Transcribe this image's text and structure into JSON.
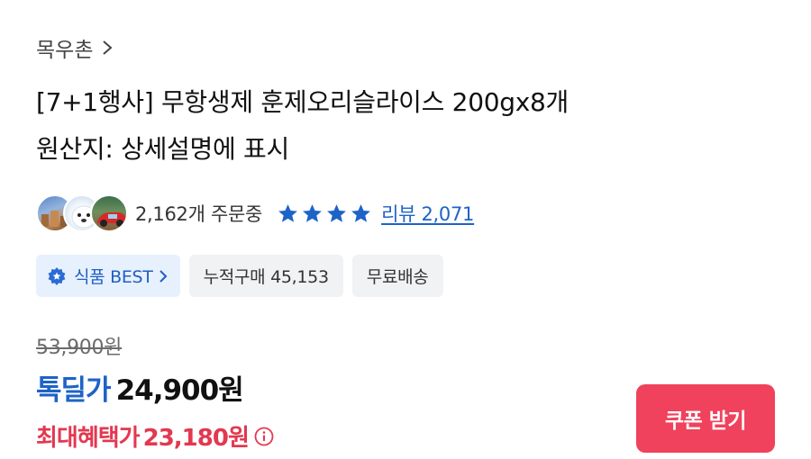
{
  "seller": {
    "name": "목우촌"
  },
  "product": {
    "title_line1": "[7+1행사] 무항생제 훈제오리슬라이스 200gx8개",
    "title_line2": "원산지: 상세설명에 표시"
  },
  "stats": {
    "orders_text": "2,162개 주문중",
    "rating_stars": 4,
    "review_link": "리뷰 2,071"
  },
  "badges": {
    "best_label": "식품 BEST",
    "cumulative_label": "누적구매 45,153",
    "shipping_label": "무료배송"
  },
  "pricing": {
    "original_price": "53,900원",
    "deal_label": "톡딜가",
    "deal_price": "24,900원",
    "max_benefit_label": "최대혜택가",
    "max_benefit_price": "23,180원"
  },
  "actions": {
    "coupon_button": "쿠폰 받기"
  },
  "icons": {
    "seller_chevron": "chevron-right-icon",
    "star": "star-icon",
    "medal": "medal-icon",
    "info": "info-icon"
  },
  "colors": {
    "accent_blue": "#1e63c7",
    "accent_red": "#e33850",
    "coupon_bg": "#f0425c",
    "best_badge_bg": "#e7f0fd",
    "neutral_badge_bg": "#f1f2f4"
  }
}
